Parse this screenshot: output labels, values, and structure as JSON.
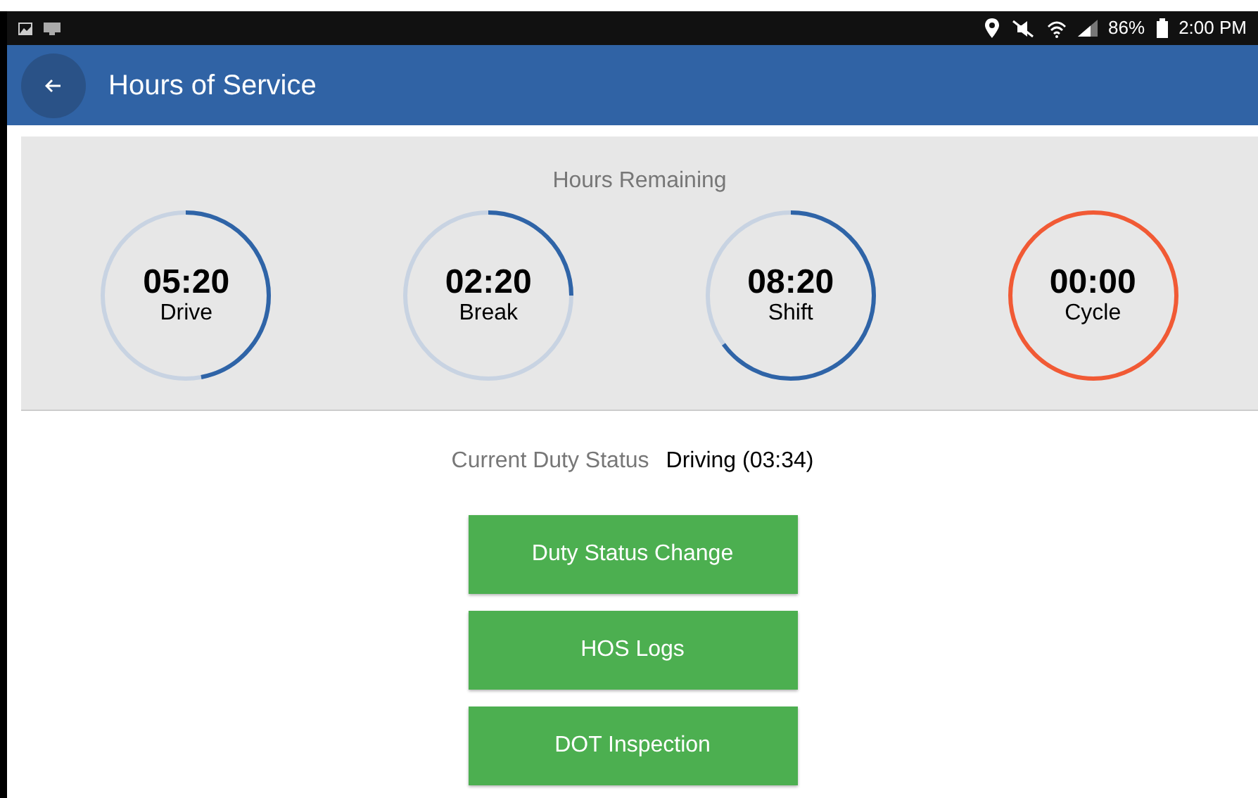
{
  "status_bar": {
    "battery": "86%",
    "time": "2:00 PM"
  },
  "app_bar": {
    "title": "Hours of Service"
  },
  "hours_remaining": {
    "title": "Hours Remaining",
    "timers": [
      {
        "value": "05:20",
        "label": "Drive",
        "level": 0.47,
        "expired": false
      },
      {
        "value": "02:20",
        "label": "Break",
        "level": 0.25,
        "expired": false
      },
      {
        "value": "08:20",
        "label": "Shift",
        "level": 0.65,
        "expired": false
      },
      {
        "value": "00:00",
        "label": "Cycle",
        "expired": true
      }
    ]
  },
  "duty_status": {
    "label": "Current Duty Status",
    "value": "Driving (03:34)"
  },
  "buttons": [
    "Duty Status Change",
    "HOS Logs",
    "DOT Inspection"
  ]
}
